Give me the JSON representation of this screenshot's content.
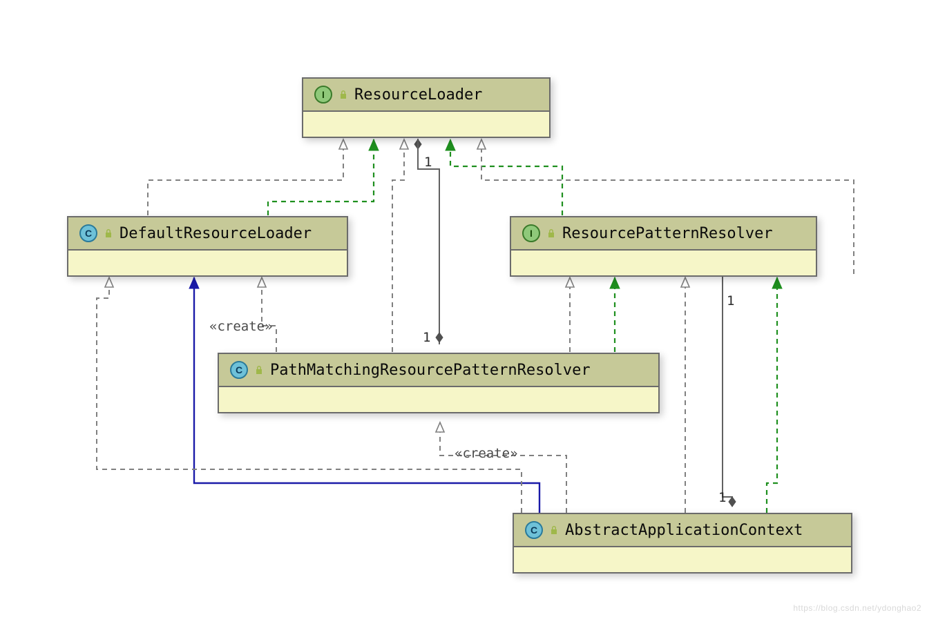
{
  "classes": {
    "resourceLoader": {
      "name": "ResourceLoader",
      "type": "I"
    },
    "defaultResourceLoader": {
      "name": "DefaultResourceLoader",
      "type": "C"
    },
    "resourcePatternResolver": {
      "name": "ResourcePatternResolver",
      "type": "I"
    },
    "pathMatching": {
      "name": "PathMatchingResourcePatternResolver",
      "type": "C"
    },
    "abstractAppCtx": {
      "name": "AbstractApplicationContext",
      "type": "C"
    }
  },
  "labels": {
    "mult_rl_1": "1",
    "mult_pm_1": "1",
    "mult_rpr_1": "1",
    "mult_aac_1": "1",
    "create1": "«create»",
    "create2": "«create»"
  },
  "watermark": "https://blog.csdn.net/ydonghao2",
  "colors": {
    "header": "#c6c998",
    "body": "#f6f6c8",
    "green": "#1e8f1e",
    "blue": "#1a1aa8",
    "gray_dash": "#808080",
    "diamond": "#505050"
  }
}
